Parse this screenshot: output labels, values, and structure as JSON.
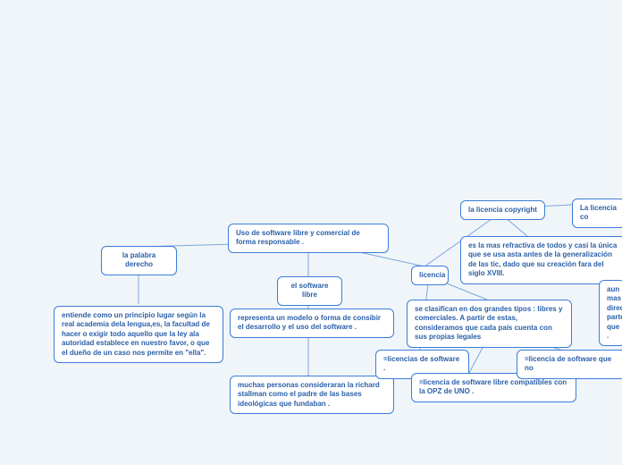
{
  "nodes": {
    "root": "Uso de software libre y comercial de forma responsable .",
    "derecho_label": "la palabra derecho",
    "derecho_desc": "entiende como un principio lugar según la real academia dela lengua,es, la facultad de hacer o exigir todo aquello que la ley ala autoridad establece en nuestro favor, o que el dueño de un caso nos permite en \"ella\".",
    "software_libre": "el software libre",
    "software_desc": "representa un modelo o forma de consibir el desarrollo y el uso del software .",
    "stallman": "muchas personas consideraran la richard stallman como el padre de las bases ideológicas que fundaban .",
    "licencia": "licencia",
    "licencia_desc": "se clasifican en dos grandes tipos : libres y comerciales. A partir de estas, consideramos que cada país cuenta con sus propias legales",
    "lic_software": "=licencias de software .",
    "lic_libre_compat": "=licencia de software libre compatibles con la OPZ de UNO .",
    "lic_no": "=licencia de software que no",
    "copyright": "la licencia copyright",
    "copyright_desc": "es la mas refractiva de todos y casi la única que se usa asta antes de la generalización de las tic, dado que su creación fara del siglo XVIII.",
    "copyright_link": "La licencia co",
    "aun": "aun mas direc parte que ."
  }
}
